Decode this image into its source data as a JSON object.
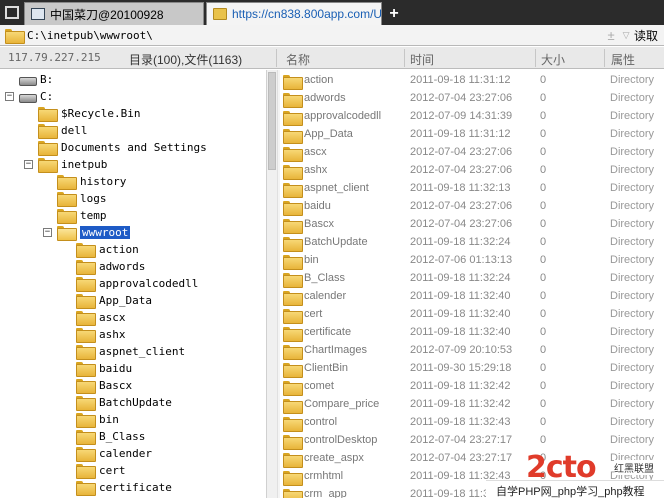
{
  "tabs": [
    {
      "title": "中国菜刀@20100928",
      "active": false
    },
    {
      "title": "https://cn838.800app.com/U...",
      "active": true
    }
  ],
  "new_tab_label": "+",
  "address": {
    "value": "C:\\inetpub\\wwwroot\\",
    "plus": "±",
    "caret": "▽",
    "read_label": "读取"
  },
  "header": {
    "ip": "117.79.227.215",
    "counts": "目录(100),文件(1163)",
    "columns": {
      "name": "名称",
      "time": "时间",
      "size": "大小",
      "attr": "属性"
    }
  },
  "tree": [
    {
      "label": "B:",
      "type": "drive",
      "toggle": ""
    },
    {
      "label": "C:",
      "type": "drive",
      "toggle": "−"
    },
    {
      "label": "$Recycle.Bin",
      "type": "folder",
      "toggle": ""
    },
    {
      "label": "dell",
      "type": "folder",
      "toggle": ""
    },
    {
      "label": "Documents and Settings",
      "type": "folder",
      "toggle": ""
    },
    {
      "label": "inetpub",
      "type": "folder",
      "toggle": "−"
    },
    {
      "label": "history",
      "type": "folder",
      "toggle": ""
    },
    {
      "label": "logs",
      "type": "folder",
      "toggle": ""
    },
    {
      "label": "temp",
      "type": "folder",
      "toggle": ""
    },
    {
      "label": "wwwroot",
      "type": "folder-open",
      "toggle": "−",
      "selected": true
    },
    {
      "label": "action",
      "type": "folder",
      "toggle": ""
    },
    {
      "label": "adwords",
      "type": "folder",
      "toggle": ""
    },
    {
      "label": "approvalcodedll",
      "type": "folder",
      "toggle": ""
    },
    {
      "label": "App_Data",
      "type": "folder",
      "toggle": ""
    },
    {
      "label": "ascx",
      "type": "folder",
      "toggle": ""
    },
    {
      "label": "ashx",
      "type": "folder",
      "toggle": ""
    },
    {
      "label": "aspnet_client",
      "type": "folder",
      "toggle": ""
    },
    {
      "label": "baidu",
      "type": "folder",
      "toggle": ""
    },
    {
      "label": "Bascx",
      "type": "folder",
      "toggle": ""
    },
    {
      "label": "BatchUpdate",
      "type": "folder",
      "toggle": ""
    },
    {
      "label": "bin",
      "type": "folder",
      "toggle": ""
    },
    {
      "label": "B_Class",
      "type": "folder",
      "toggle": ""
    },
    {
      "label": "calender",
      "type": "folder",
      "toggle": ""
    },
    {
      "label": "cert",
      "type": "folder",
      "toggle": ""
    },
    {
      "label": "certificate",
      "type": "folder",
      "toggle": ""
    },
    {
      "label": "",
      "type": "folder",
      "toggle": ""
    }
  ],
  "files": [
    {
      "name": "action",
      "time": "2011-09-18 11:31:12",
      "size": "0",
      "attr": "Directory"
    },
    {
      "name": "adwords",
      "time": "2012-07-04 23:27:06",
      "size": "0",
      "attr": "Directory"
    },
    {
      "name": "approvalcodedll",
      "time": "2012-07-09 14:31:39",
      "size": "0",
      "attr": "Directory"
    },
    {
      "name": "App_Data",
      "time": "2011-09-18 11:31:12",
      "size": "0",
      "attr": "Directory"
    },
    {
      "name": "ascx",
      "time": "2012-07-04 23:27:06",
      "size": "0",
      "attr": "Directory"
    },
    {
      "name": "ashx",
      "time": "2012-07-04 23:27:06",
      "size": "0",
      "attr": "Directory"
    },
    {
      "name": "aspnet_client",
      "time": "2011-09-18 11:32:13",
      "size": "0",
      "attr": "Directory"
    },
    {
      "name": "baidu",
      "time": "2012-07-04 23:27:06",
      "size": "0",
      "attr": "Directory"
    },
    {
      "name": "Bascx",
      "time": "2012-07-04 23:27:06",
      "size": "0",
      "attr": "Directory"
    },
    {
      "name": "BatchUpdate",
      "time": "2011-09-18 11:32:24",
      "size": "0",
      "attr": "Directory"
    },
    {
      "name": "bin",
      "time": "2012-07-06 01:13:13",
      "size": "0",
      "attr": "Directory"
    },
    {
      "name": "B_Class",
      "time": "2011-09-18 11:32:24",
      "size": "0",
      "attr": "Directory"
    },
    {
      "name": "calender",
      "time": "2011-09-18 11:32:40",
      "size": "0",
      "attr": "Directory"
    },
    {
      "name": "cert",
      "time": "2011-09-18 11:32:40",
      "size": "0",
      "attr": "Directory"
    },
    {
      "name": "certificate",
      "time": "2011-09-18 11:32:40",
      "size": "0",
      "attr": "Directory"
    },
    {
      "name": "ChartImages",
      "time": "2012-07-09 20:10:53",
      "size": "0",
      "attr": "Directory"
    },
    {
      "name": "ClientBin",
      "time": "2011-09-30 15:29:18",
      "size": "0",
      "attr": "Directory"
    },
    {
      "name": "comet",
      "time": "2011-09-18 11:32:42",
      "size": "0",
      "attr": "Directory"
    },
    {
      "name": "Compare_price",
      "time": "2011-09-18 11:32:42",
      "size": "0",
      "attr": "Directory"
    },
    {
      "name": "control",
      "time": "2011-09-18 11:32:43",
      "size": "0",
      "attr": "Directory"
    },
    {
      "name": "controlDesktop",
      "time": "2012-07-04 23:27:17",
      "size": "0",
      "attr": "Directory"
    },
    {
      "name": "create_aspx",
      "time": "2012-07-04 23:27:17",
      "size": "0",
      "attr": "Directory"
    },
    {
      "name": "crmhtml",
      "time": "2011-09-18 11:32:43",
      "size": "0",
      "attr": "Directory"
    },
    {
      "name": "crm_app",
      "time": "2011-09-18 11:32:43",
      "size": "0",
      "attr": "Directory"
    }
  ],
  "watermark": {
    "logo": "2cto",
    "tag": "红黑联盟",
    "bar": "自学PHP网_php学习_php教程"
  }
}
